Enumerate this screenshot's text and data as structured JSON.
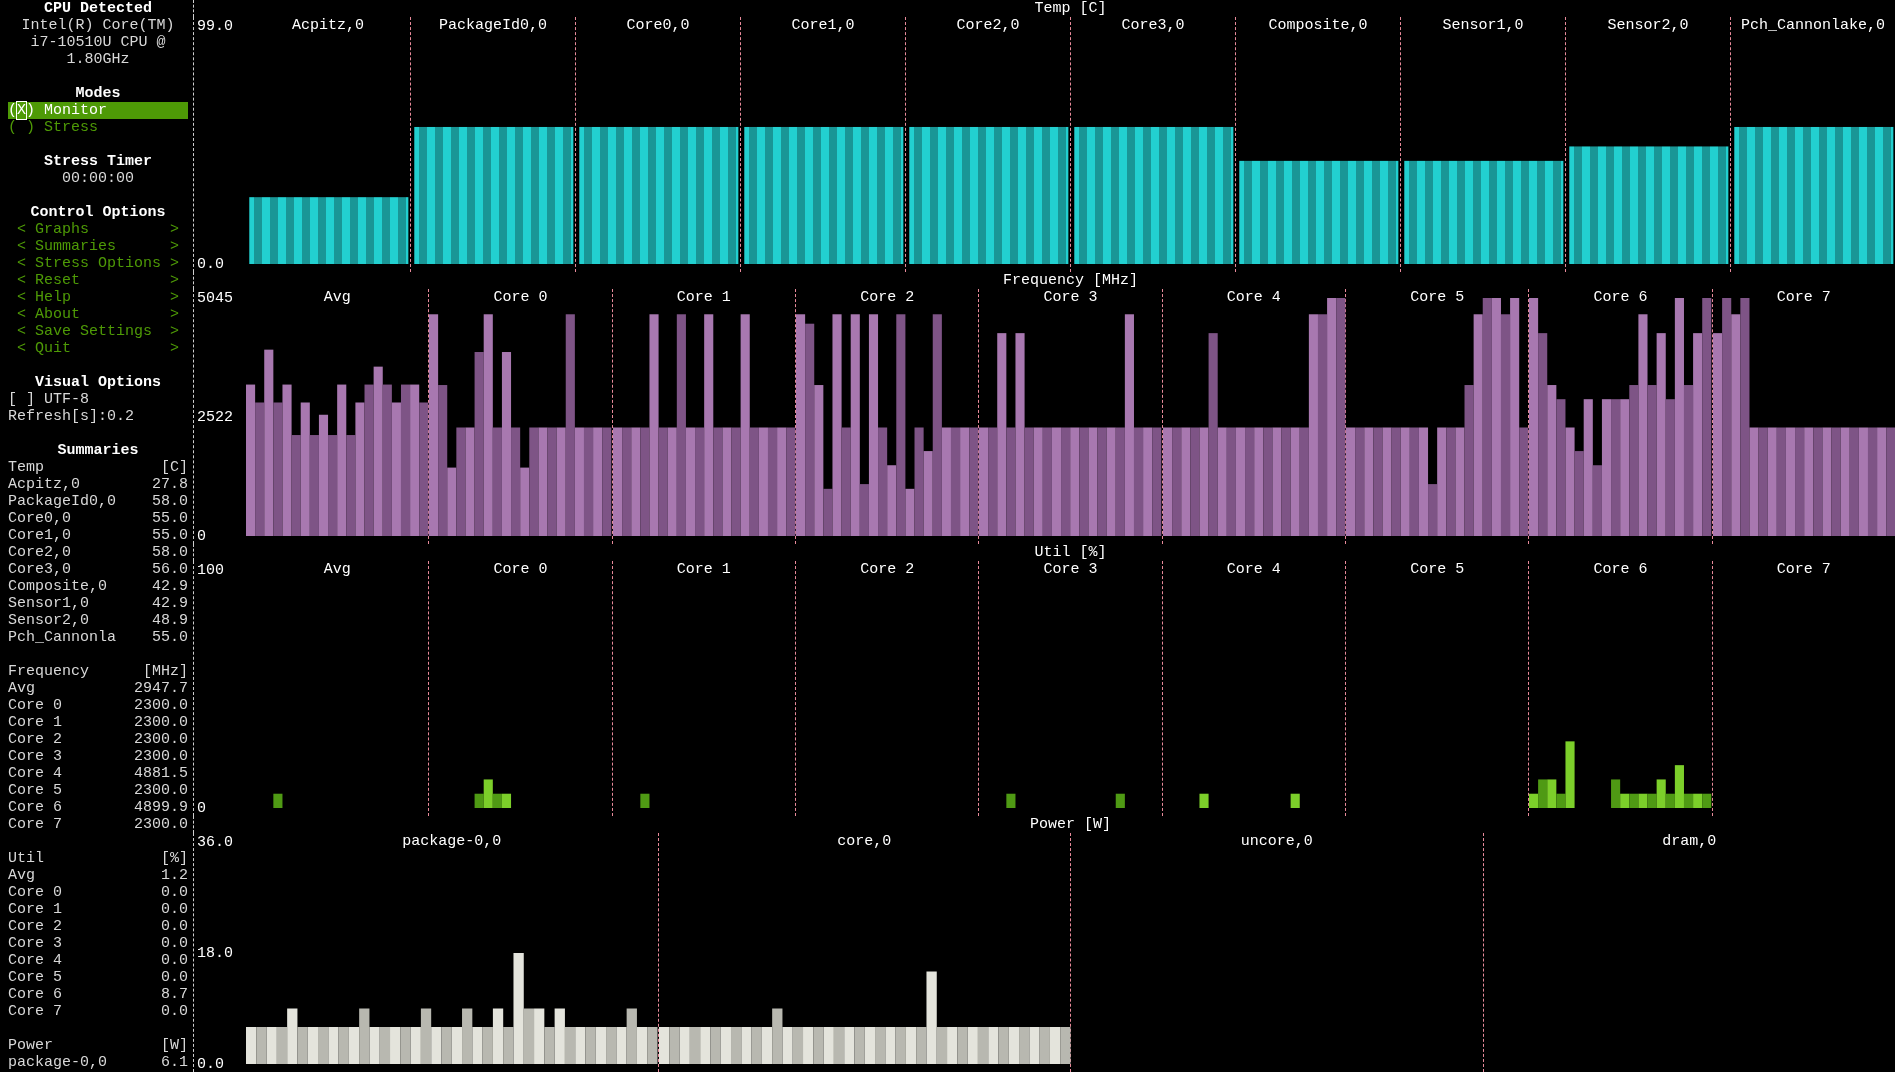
{
  "sidebar": {
    "cpu": {
      "title": "CPU Detected",
      "lines": [
        "Intel(R) Core(TM)",
        "i7-10510U CPU @",
        "1.80GHz"
      ]
    },
    "modes": {
      "title": "Modes",
      "items": [
        {
          "marker": "(X)",
          "label": "Monitor",
          "selected": true
        },
        {
          "marker": "( )",
          "label": "Stress",
          "selected": false
        }
      ]
    },
    "stress_timer": {
      "title": "Stress Timer",
      "value": "00:00:00"
    },
    "control_options": {
      "title": "Control Options",
      "items": [
        {
          "open": "<",
          "label": "Graphs",
          "close": ">"
        },
        {
          "open": "<",
          "label": "Summaries",
          "close": ">"
        },
        {
          "open": "<",
          "label": "Stress Options",
          "close": ">"
        },
        {
          "open": "<",
          "label": "Reset",
          "close": ">"
        },
        {
          "open": "<",
          "label": "Help",
          "close": ">"
        },
        {
          "open": "<",
          "label": "About",
          "close": ">"
        },
        {
          "open": "<",
          "label": "Save Settings",
          "close": ">"
        },
        {
          "open": "<",
          "label": "Quit",
          "close": ">"
        }
      ]
    },
    "visual_options": {
      "title": "Visual Options",
      "utf8": {
        "box": "[ ]",
        "label": "UTF-8",
        "checked": false
      },
      "refresh": "Refresh[s]:0.2"
    },
    "summaries": {
      "title": "Summaries",
      "groups": [
        {
          "name": "Temp",
          "unit": "[C]",
          "rows": [
            {
              "label": "Acpitz,0",
              "value": "27.8"
            },
            {
              "label": "PackageId0,0",
              "value": "58.0"
            },
            {
              "label": "Core0,0",
              "value": "55.0"
            },
            {
              "label": "Core1,0",
              "value": "55.0"
            },
            {
              "label": "Core2,0",
              "value": "58.0"
            },
            {
              "label": "Core3,0",
              "value": "56.0"
            },
            {
              "label": "Composite,0",
              "value": "42.9"
            },
            {
              "label": "Sensor1,0",
              "value": "42.9"
            },
            {
              "label": "Sensor2,0",
              "value": "48.9"
            },
            {
              "label": "Pch_Cannonla",
              "value": "55.0"
            }
          ]
        },
        {
          "name": "Frequency",
          "unit": "[MHz]",
          "rows": [
            {
              "label": "Avg",
              "value": "2947.7"
            },
            {
              "label": "Core 0",
              "value": "2300.0"
            },
            {
              "label": "Core 1",
              "value": "2300.0"
            },
            {
              "label": "Core 2",
              "value": "2300.0"
            },
            {
              "label": "Core 3",
              "value": "2300.0"
            },
            {
              "label": "Core 4",
              "value": "4881.5"
            },
            {
              "label": "Core 5",
              "value": "2300.0"
            },
            {
              "label": "Core 6",
              "value": "4899.9"
            },
            {
              "label": "Core 7",
              "value": "2300.0"
            }
          ]
        },
        {
          "name": "Util",
          "unit": "[%]",
          "rows": [
            {
              "label": "Avg",
              "value": "1.2"
            },
            {
              "label": "Core 0",
              "value": "0.0"
            },
            {
              "label": "Core 1",
              "value": "0.0"
            },
            {
              "label": "Core 2",
              "value": "0.0"
            },
            {
              "label": "Core 3",
              "value": "0.0"
            },
            {
              "label": "Core 4",
              "value": "0.0"
            },
            {
              "label": "Core 5",
              "value": "0.0"
            },
            {
              "label": "Core 6",
              "value": "8.7"
            },
            {
              "label": "Core 7",
              "value": "0.0"
            }
          ]
        },
        {
          "name": "Power",
          "unit": "[W]",
          "rows": [
            {
              "label": "package-0,0",
              "value": "6.1"
            }
          ]
        }
      ]
    }
  },
  "graphs": [
    {
      "chart_data": {
        "type": "bar",
        "title": "Temp [C]",
        "ylim": [
          0,
          99
        ],
        "yticks": [
          {
            "value": 99,
            "label": "99.0"
          },
          {
            "value": 0,
            "label": "0.0"
          }
        ],
        "categories": [
          "Acpitz,0",
          "PackageId0,0",
          "Core0,0",
          "Core1,0",
          "Core2,0",
          "Core3,0",
          "Composite,0",
          "Sensor1,0",
          "Sensor2,0",
          "Pch_Cannonlake,0"
        ],
        "series": [
          {
            "color": "#22d0d0",
            "values": [
              27.8,
              57.0,
              57.0,
              57.0,
              57.0,
              57.0,
              42.9,
              42.9,
              48.9,
              57.0
            ]
          }
        ]
      }
    },
    {
      "chart_data": {
        "type": "bar",
        "title": "Frequency [MHz]",
        "ylim": [
          0,
          5045
        ],
        "yticks": [
          {
            "value": 5045,
            "label": "5045"
          },
          {
            "value": 2522,
            "label": "2522"
          },
          {
            "value": 0,
            "label": "0"
          }
        ],
        "categories": [
          "Avg",
          "Core 0",
          "Core 1",
          "Core 2",
          "Core 3",
          "Core 4",
          "Core 5",
          "Core 6",
          "Core 7"
        ],
        "series": [
          {
            "color": "#a878b0",
            "values": [
              3210,
              4700,
              2300,
              4700,
              2300,
              2300,
              2300,
              5045,
              4300
            ]
          },
          {
            "color": "#7e5486",
            "values": [
              2830,
              3200,
              2300,
              4500,
              2300,
              2300,
              2300,
              4300,
              5045
            ]
          },
          {
            "color": "#a878b0",
            "values": [
              3950,
              1450,
              2300,
              3200,
              4300,
              2300,
              2300,
              3200,
              4700
            ]
          },
          {
            "color": "#7e5486",
            "values": [
              2830,
              2300,
              2300,
              1000,
              2300,
              2300,
              2300,
              2900,
              5045
            ]
          },
          {
            "color": "#a878b0",
            "values": [
              3210,
              2300,
              4700,
              4700,
              4300,
              2300,
              2300,
              2300,
              2300
            ]
          },
          {
            "color": "#7e5486",
            "values": [
              2140,
              3900,
              2300,
              2300,
              2300,
              4300,
              2300,
              1800,
              2300
            ]
          },
          {
            "color": "#a878b0",
            "values": [
              2830,
              4700,
              2300,
              4700,
              2300,
              2300,
              2300,
              2900,
              2300
            ]
          },
          {
            "color": "#7e5486",
            "values": [
              2140,
              2300,
              4700,
              1100,
              2300,
              2300,
              2300,
              1500,
              2300
            ]
          },
          {
            "color": "#a878b0",
            "values": [
              2570,
              3900,
              2300,
              4700,
              2300,
              2300,
              2300,
              2900,
              2300
            ]
          },
          {
            "color": "#7e5486",
            "values": [
              2140,
              2300,
              2300,
              2300,
              2300,
              2300,
              1100,
              2900,
              2300
            ]
          },
          {
            "color": "#a878b0",
            "values": [
              3210,
              1450,
              4700,
              1500,
              2300,
              2300,
              2300,
              2900,
              2300
            ]
          },
          {
            "color": "#7e5486",
            "values": [
              2140,
              2300,
              2300,
              4700,
              2300,
              2300,
              2300,
              3200,
              2300
            ]
          },
          {
            "color": "#a878b0",
            "values": [
              2830,
              2300,
              2300,
              1000,
              2300,
              2300,
              2300,
              4700,
              2300
            ]
          },
          {
            "color": "#7e5486",
            "values": [
              3210,
              2300,
              2300,
              2300,
              2300,
              2300,
              3200,
              3200,
              2300
            ]
          },
          {
            "color": "#a878b0",
            "values": [
              3590,
              2300,
              4700,
              1800,
              2300,
              2300,
              4700,
              4300,
              2300
            ]
          },
          {
            "color": "#7e5486",
            "values": [
              3210,
              4700,
              2300,
              4700,
              2300,
              2300,
              5045,
              2900,
              2300
            ]
          },
          {
            "color": "#a878b0",
            "values": [
              2830,
              2300,
              2300,
              2300,
              4700,
              4700,
              5045,
              5045,
              2300
            ]
          },
          {
            "color": "#7e5486",
            "values": [
              3210,
              2300,
              2300,
              2300,
              2300,
              4700,
              4700,
              3200,
              2300
            ]
          },
          {
            "color": "#a878b0",
            "values": [
              3210,
              2300,
              2300,
              2300,
              2300,
              5045,
              5045,
              4300,
              2300
            ]
          },
          {
            "color": "#7e5486",
            "values": [
              2830,
              2300,
              2300,
              2300,
              2300,
              5045,
              2300,
              5045,
              2300
            ]
          }
        ]
      }
    },
    {
      "chart_data": {
        "type": "bar",
        "title": "Util [%]",
        "ylim": [
          0,
          100
        ],
        "yticks": [
          {
            "value": 100,
            "label": "100"
          },
          {
            "value": 0,
            "label": "0"
          }
        ],
        "categories": [
          "Avg",
          "Core 0",
          "Core 1",
          "Core 2",
          "Core 3",
          "Core 4",
          "Core 5",
          "Core 6",
          "Core 7"
        ],
        "series": [
          {
            "color": "#7ccf2a",
            "values": [
              0,
              0,
              0,
              0,
              0,
              0,
              0,
              6,
              0
            ]
          },
          {
            "color": "#4f9a14",
            "values": [
              0,
              0,
              0,
              0,
              0,
              0,
              0,
              12,
              0
            ]
          },
          {
            "color": "#7ccf2a",
            "values": [
              0,
              0,
              0,
              0,
              0,
              0,
              0,
              12,
              0
            ]
          },
          {
            "color": "#4f9a14",
            "values": [
              6,
              0,
              6,
              0,
              6,
              0,
              0,
              6,
              0
            ]
          },
          {
            "color": "#7ccf2a",
            "values": [
              0,
              0,
              0,
              0,
              0,
              6,
              0,
              28,
              0
            ]
          },
          {
            "color": "#4f9a14",
            "values": [
              0,
              6,
              0,
              0,
              0,
              0,
              0,
              0,
              0
            ]
          },
          {
            "color": "#7ccf2a",
            "values": [
              0,
              12,
              0,
              0,
              0,
              0,
              0,
              0,
              0
            ]
          },
          {
            "color": "#4f9a14",
            "values": [
              0,
              6,
              0,
              0,
              0,
              0,
              0,
              0,
              0
            ]
          },
          {
            "color": "#7ccf2a",
            "values": [
              0,
              6,
              0,
              0,
              0,
              0,
              0,
              0,
              0
            ]
          },
          {
            "color": "#4f9a14",
            "values": [
              0,
              0,
              0,
              0,
              0,
              0,
              0,
              12,
              0
            ]
          },
          {
            "color": "#7ccf2a",
            "values": [
              0,
              0,
              0,
              0,
              0,
              0,
              0,
              6,
              0
            ]
          },
          {
            "color": "#4f9a14",
            "values": [
              0,
              0,
              0,
              0,
              0,
              0,
              0,
              6,
              0
            ]
          },
          {
            "color": "#7ccf2a",
            "values": [
              0,
              0,
              0,
              0,
              0,
              0,
              0,
              6,
              0
            ]
          },
          {
            "color": "#4f9a14",
            "values": [
              0,
              0,
              0,
              0,
              0,
              0,
              0,
              6,
              0
            ]
          },
          {
            "color": "#7ccf2a",
            "values": [
              0,
              0,
              0,
              0,
              0,
              6,
              0,
              12,
              0
            ]
          },
          {
            "color": "#4f9a14",
            "values": [
              0,
              0,
              0,
              0,
              6,
              0,
              0,
              6,
              0
            ]
          },
          {
            "color": "#7ccf2a",
            "values": [
              0,
              0,
              0,
              0,
              0,
              0,
              0,
              18,
              0
            ]
          },
          {
            "color": "#4f9a14",
            "values": [
              0,
              0,
              0,
              0,
              0,
              0,
              0,
              6,
              0
            ]
          },
          {
            "color": "#7ccf2a",
            "values": [
              0,
              0,
              0,
              0,
              0,
              0,
              0,
              6,
              0
            ]
          },
          {
            "color": "#4f9a14",
            "values": [
              0,
              0,
              0,
              0,
              0,
              0,
              0,
              6,
              0
            ]
          }
        ]
      }
    },
    {
      "chart_data": {
        "type": "bar",
        "title": "Power [W]",
        "ylim": [
          0,
          36
        ],
        "yticks": [
          {
            "value": 36,
            "label": "36.0"
          },
          {
            "value": 18,
            "label": "18.0"
          },
          {
            "value": 0,
            "label": "0.0"
          }
        ],
        "categories": [
          "package-0,0",
          "core,0",
          "uncore,0",
          "dram,0"
        ],
        "series": [
          {
            "color": "#e4e4dc",
            "values": [
              6,
              6,
              null,
              null
            ]
          },
          {
            "color": "#b8b8b0",
            "values": [
              6,
              6,
              null,
              null
            ]
          },
          {
            "color": "#e4e4dc",
            "values": [
              6,
              6,
              null,
              null
            ]
          },
          {
            "color": "#b8b8b0",
            "values": [
              6,
              6,
              null,
              null
            ]
          },
          {
            "color": "#e4e4dc",
            "values": [
              9,
              6,
              null,
              null
            ]
          },
          {
            "color": "#b8b8b0",
            "values": [
              6,
              6,
              null,
              null
            ]
          },
          {
            "color": "#e4e4dc",
            "values": [
              6,
              6,
              null,
              null
            ]
          },
          {
            "color": "#b8b8b0",
            "values": [
              6,
              6,
              null,
              null
            ]
          },
          {
            "color": "#e4e4dc",
            "values": [
              6,
              6,
              null,
              null
            ]
          },
          {
            "color": "#b8b8b0",
            "values": [
              6,
              6,
              null,
              null
            ]
          },
          {
            "color": "#e4e4dc",
            "values": [
              6,
              6,
              null,
              null
            ]
          },
          {
            "color": "#b8b8b0",
            "values": [
              9,
              9,
              null,
              null
            ]
          },
          {
            "color": "#e4e4dc",
            "values": [
              6,
              6,
              null,
              null
            ]
          },
          {
            "color": "#b8b8b0",
            "values": [
              6,
              6,
              null,
              null
            ]
          },
          {
            "color": "#e4e4dc",
            "values": [
              6,
              6,
              null,
              null
            ]
          },
          {
            "color": "#b8b8b0",
            "values": [
              6,
              6,
              null,
              null
            ]
          },
          {
            "color": "#e4e4dc",
            "values": [
              6,
              6,
              null,
              null
            ]
          },
          {
            "color": "#b8b8b0",
            "values": [
              9,
              6,
              null,
              null
            ]
          },
          {
            "color": "#e4e4dc",
            "values": [
              6,
              6,
              null,
              null
            ]
          },
          {
            "color": "#b8b8b0",
            "values": [
              6,
              6,
              null,
              null
            ]
          },
          {
            "color": "#e4e4dc",
            "values": [
              6,
              6,
              null,
              null
            ]
          },
          {
            "color": "#b8b8b0",
            "values": [
              9,
              6,
              null,
              null
            ]
          },
          {
            "color": "#e4e4dc",
            "values": [
              6,
              6,
              null,
              null
            ]
          },
          {
            "color": "#b8b8b0",
            "values": [
              6,
              6,
              null,
              null
            ]
          },
          {
            "color": "#e4e4dc",
            "values": [
              9,
              6,
              null,
              null
            ]
          },
          {
            "color": "#b8b8b0",
            "values": [
              6,
              6,
              null,
              null
            ]
          },
          {
            "color": "#e4e4dc",
            "values": [
              18,
              15,
              null,
              null
            ]
          },
          {
            "color": "#b8b8b0",
            "values": [
              9,
              6,
              null,
              null
            ]
          },
          {
            "color": "#e4e4dc",
            "values": [
              9,
              6,
              null,
              null
            ]
          },
          {
            "color": "#b8b8b0",
            "values": [
              6,
              6,
              null,
              null
            ]
          },
          {
            "color": "#e4e4dc",
            "values": [
              9,
              6,
              null,
              null
            ]
          },
          {
            "color": "#b8b8b0",
            "values": [
              6,
              6,
              null,
              null
            ]
          },
          {
            "color": "#e4e4dc",
            "values": [
              6,
              6,
              null,
              null
            ]
          },
          {
            "color": "#b8b8b0",
            "values": [
              6,
              6,
              null,
              null
            ]
          },
          {
            "color": "#e4e4dc",
            "values": [
              6,
              6,
              null,
              null
            ]
          },
          {
            "color": "#b8b8b0",
            "values": [
              6,
              6,
              null,
              null
            ]
          },
          {
            "color": "#e4e4dc",
            "values": [
              6,
              6,
              null,
              null
            ]
          },
          {
            "color": "#b8b8b0",
            "values": [
              9,
              6,
              null,
              null
            ]
          },
          {
            "color": "#e4e4dc",
            "values": [
              6,
              6,
              null,
              null
            ]
          },
          {
            "color": "#b8b8b0",
            "values": [
              6,
              6,
              null,
              null
            ]
          }
        ]
      }
    }
  ]
}
